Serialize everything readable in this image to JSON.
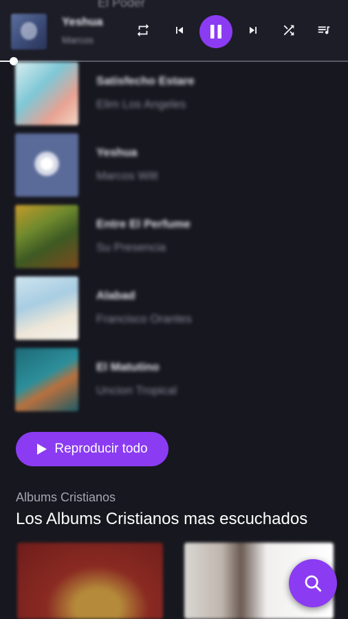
{
  "player": {
    "title": "Yeshua",
    "artist": "Marcos",
    "ghost_header": "El Poder",
    "progress_fraction": 0.04,
    "controls": {
      "repeat": "repeat-icon",
      "previous": "skip-previous-icon",
      "play_pause": "pause-icon",
      "next": "skip-next-icon",
      "shuffle": "shuffle-icon",
      "queue": "queue-music-icon"
    },
    "accent_color": "#8b3cf2"
  },
  "songs": [
    {
      "title": "Satisfecho Estare",
      "artist": "Elim Los Angeles"
    },
    {
      "title": "Yeshua",
      "artist": "Marcos Witt"
    },
    {
      "title": "Entre El Perfume",
      "artist": "Su Presencia"
    },
    {
      "title": "Alabad",
      "artist": "Francisco Orantes"
    },
    {
      "title": "El Matutino",
      "artist": "Uncion Tropical"
    }
  ],
  "play_all": {
    "label": "Reproducir todo",
    "icon": "play-icon"
  },
  "section": {
    "kicker": "Albums Cristianos",
    "title": "Los Albums Cristianos mas escuchados"
  },
  "fab": {
    "icon": "search-icon"
  },
  "colors": {
    "background": "#17171f",
    "player_bar": "#1d1d27",
    "accent": "#8b3cf2"
  }
}
